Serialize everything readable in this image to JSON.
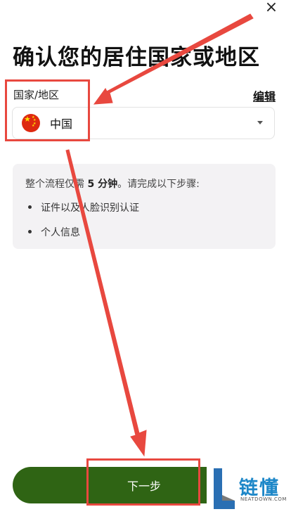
{
  "header": {
    "close_icon_glyph": "×",
    "title": "确认您的居住国家或地区"
  },
  "country_field": {
    "label": "国家/地区",
    "edit_label": "编辑",
    "selected_value": "中国",
    "flag_icon": "china-flag-icon"
  },
  "info": {
    "text_prefix": "整个流程仅需 ",
    "text_bold": "5 分钟",
    "text_suffix": "。请完成以下步骤:",
    "steps": [
      "证件以及人脸识别认证",
      "个人信息"
    ]
  },
  "footer": {
    "next_label": "下一步"
  },
  "watermark": {
    "text": "链懂",
    "sub": "NEATDOWN.COM"
  },
  "colors": {
    "primary_button": "#2f6414",
    "annotation": "#e8483f",
    "card_bg": "#f3f2f4"
  }
}
